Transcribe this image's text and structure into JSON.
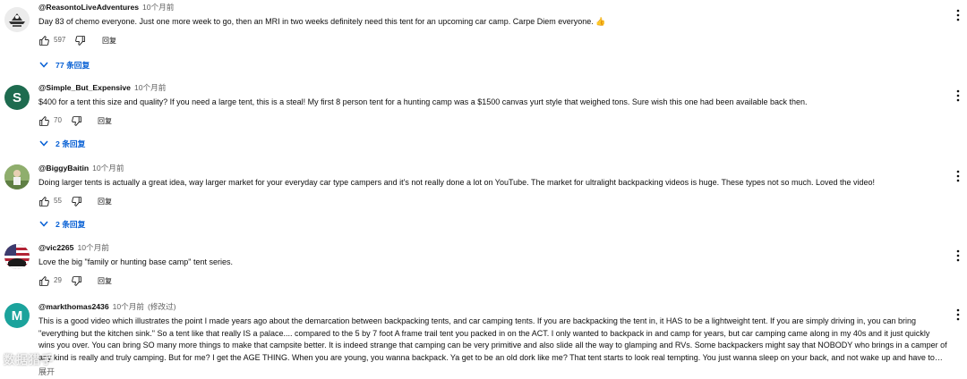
{
  "comments": [
    {
      "author": "@ReasontoLiveAdventures",
      "time": "10个月前",
      "text": "Day 83 of chemo everyone. Just one more week to go, then an MRI in two weeks  definitely need this tent for an upcoming car camp. Carpe Diem everyone. 👍",
      "likes": "597",
      "reply_label": "回复",
      "replies_label": "77 条回复",
      "avatar_letter": "",
      "avatar_color": "#e9e9e9"
    },
    {
      "author": "@Simple_But_Expensive",
      "time": "10个月前",
      "text": "$400 for a tent this size and quality?  If you need a large tent, this is a steal!  My first 8 person tent for a hunting camp was a $1500 canvas yurt style that weighed tons.  Sure wish this one had been available back then.",
      "likes": "70",
      "reply_label": "回复",
      "replies_label": "2 条回复",
      "avatar_letter": "S",
      "avatar_color": "#1e6b4f"
    },
    {
      "author": "@BiggyBaitin",
      "time": "10个月前",
      "text": "Doing larger tents is actually a great idea, way larger market for your everyday car type campers and it's not really done a lot on YouTube. The market for ultralight backpacking videos is huge. These types not so much. Loved the video!",
      "likes": "55",
      "reply_label": "回复",
      "replies_label": "2 条回复",
      "avatar_letter": "",
      "avatar_color": "#7f9a63"
    },
    {
      "author": "@vic2265",
      "time": "10个月前",
      "text": "Love the big \"family or hunting base camp\" tent series.",
      "likes": "29",
      "reply_label": "回复",
      "replies_label": "",
      "avatar_letter": "",
      "avatar_color": "#2a2a3a"
    },
    {
      "author": "@markthomas2436",
      "time": "10个月前",
      "edited": "(修改过)",
      "text": "This is a good video which illustrates the point I made years ago about the demarcation between backpacking tents, and car camping tents. If you are backpacking the tent in, it HAS to be a lightweight tent. If you are simply driving in, you can bring \"everything but the kitchen sink.\" So a tent like that really IS a palace.... compared to the 5 by 7 foot A frame trail tent you packed in on the ACT. I only wanted to backpack in and camp for years, but car camping came along in my 40s and it just quickly wins you over. You can bring SO many more things to make that campsite better. It is indeed strange that camping can be very primitive and also slide all the way to glamping and RVs. Some backpackers might say that NOBODY who brings in a camper of any kind is really and truly camping. But for me? I get the AGE THING. When you are young, you wanna backpack. Ya get to be an old dork like me? That tent starts to look real tempting. You just wanna sleep on your back, and not wake up and have to crawl out of your bed! lol",
      "expand_label": "展开",
      "avatar_letter": "M",
      "avatar_color": "#1ba39c"
    }
  ],
  "watermark": "数据猎手"
}
